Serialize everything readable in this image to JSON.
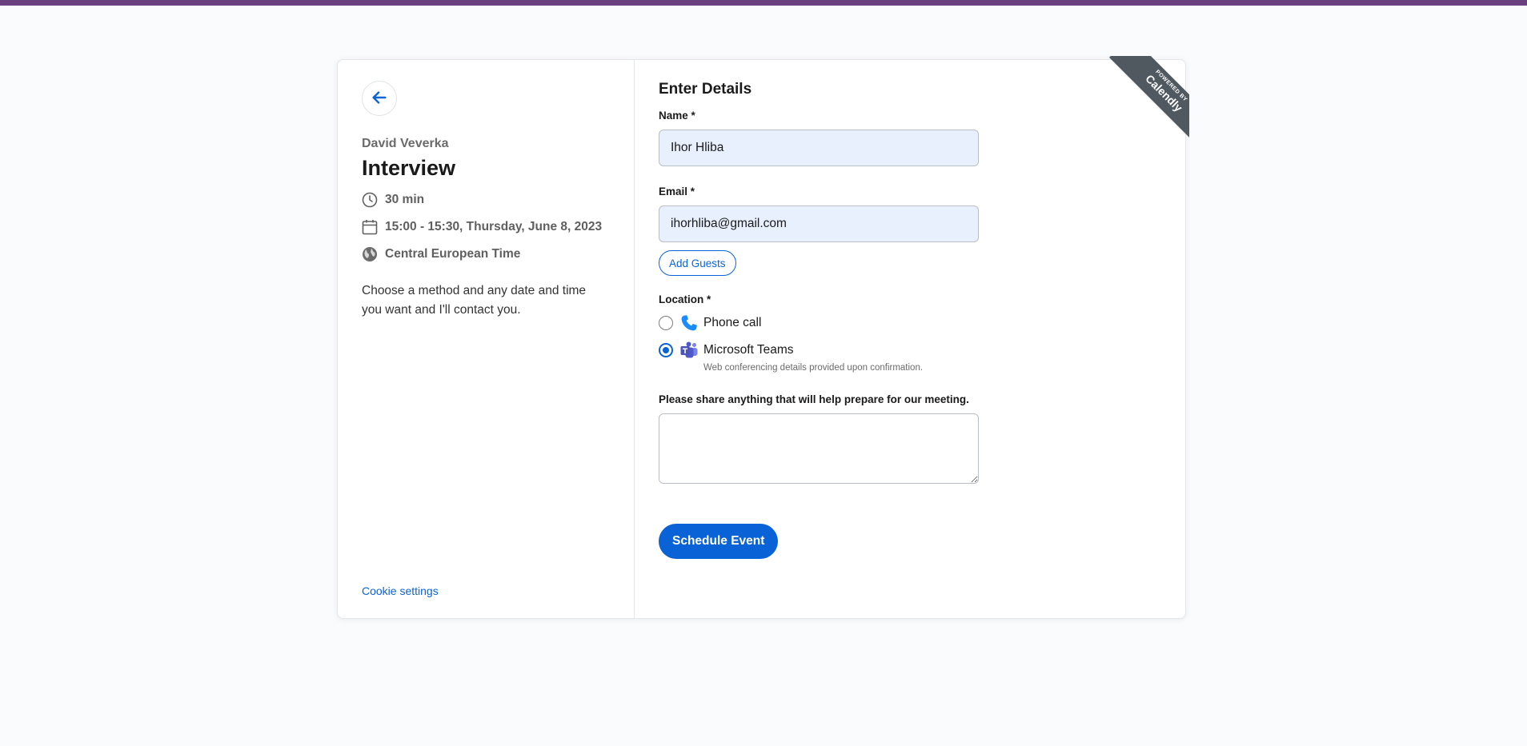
{
  "theme": {
    "top_bar_color": "#6b4080",
    "accent": "#0a63d6",
    "ribbon_color": "#505860"
  },
  "event": {
    "back_icon": "arrow-left-icon",
    "organizer": "David Veverka",
    "title": "Interview",
    "duration": "30 min",
    "datetime": "15:00 - 15:30, Thursday, June 8, 2023",
    "timezone": "Central European Time",
    "description": "Choose a method and any date and time you want and I'll contact you.",
    "cookie_settings": "Cookie settings"
  },
  "form": {
    "title": "Enter Details",
    "name_label": "Name *",
    "name_value": "Ihor Hliba",
    "email_label": "Email *",
    "email_value": "ihorhliba@gmail.com",
    "add_guests": "Add Guests",
    "location_label": "Location *",
    "location_options": [
      {
        "label": "Phone call",
        "icon": "phone-icon",
        "selected": false
      },
      {
        "label": "Microsoft Teams",
        "icon": "microsoft-teams-icon",
        "selected": true
      }
    ],
    "web_note": "Web conferencing details provided upon confirmation.",
    "notes_label": "Please share anything that will help prepare for our meeting.",
    "notes_value": "",
    "submit": "Schedule Event"
  },
  "ribbon": {
    "line1": "POWERED BY",
    "line2": "Calendly"
  }
}
